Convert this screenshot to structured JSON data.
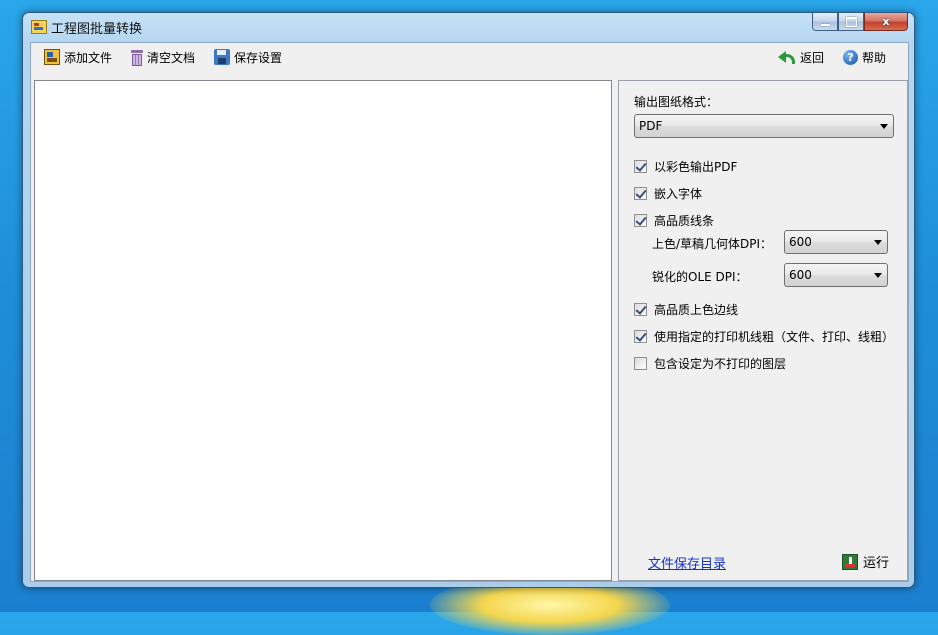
{
  "window": {
    "title": "工程图批量转换",
    "caption_buttons": {
      "minimize": "—",
      "maximize": "□",
      "close": "x"
    }
  },
  "toolbar": {
    "add_files": "添加文件",
    "clear_docs": "清空文档",
    "save_settings": "保存设置",
    "back": "返回",
    "help": "帮助",
    "help_glyph": "?"
  },
  "options": {
    "output_format_label": "输出图纸格式：",
    "output_format_value": "PDF",
    "checkboxes": [
      {
        "label": "以彩色输出PDF",
        "checked": true
      },
      {
        "label": "嵌入字体",
        "checked": true
      },
      {
        "label": "高品质线条",
        "checked": true
      },
      {
        "label": "高品质上色边线",
        "checked": true
      },
      {
        "label": "使用指定的打印机线粗（文件、打印、线粗）",
        "checked": true
      },
      {
        "label": "包含设定为不打印的图层",
        "checked": false
      }
    ],
    "shaded_dpi_label": "上色/草稿几何体DPI：",
    "shaded_dpi_value": "600",
    "ole_dpi_label": "锐化的OLE   DPI：",
    "ole_dpi_value": "600",
    "save_dir_link": "文件保存目录",
    "run_label": "运行"
  },
  "icons": [
    "app-icon",
    "add-file-icon",
    "trash-icon",
    "save-icon",
    "back-arrow-icon",
    "help-icon",
    "run-icon"
  ]
}
